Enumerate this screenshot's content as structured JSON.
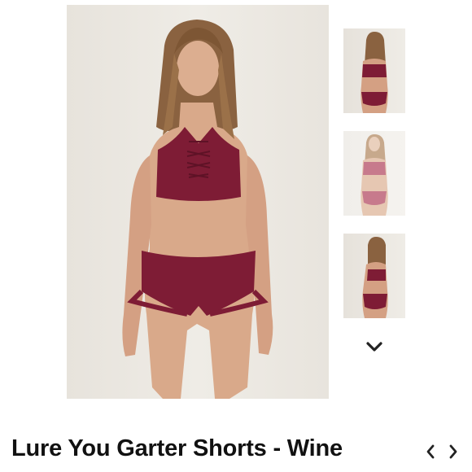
{
  "product": {
    "title": "Lure You Garter Shorts - Wine",
    "color": "Wine",
    "wine_hex": "#7e1c35"
  },
  "gallery": {
    "main_image": "model-front-view",
    "thumbnails": [
      "model-back-view",
      "model-front-faded-view",
      "model-side-view"
    ],
    "scroll_icon": "chevron-down-icon"
  },
  "pagination": {
    "prev_icon": "chevron-left-icon",
    "next_icon": "chevron-right-icon"
  }
}
